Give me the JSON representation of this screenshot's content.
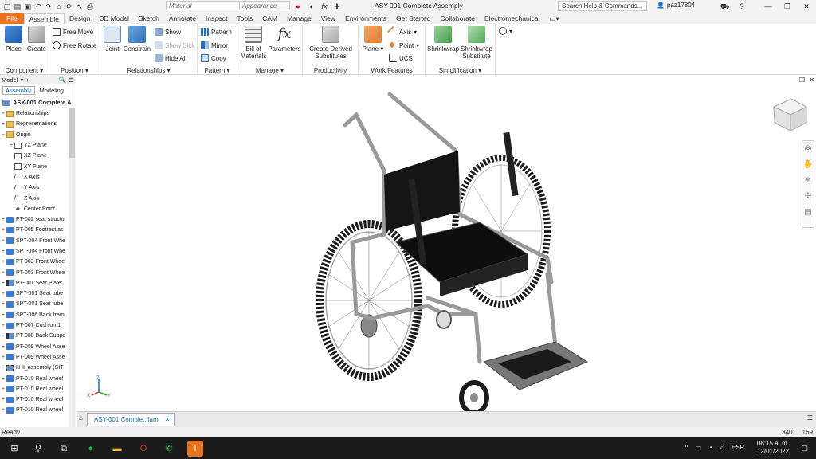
{
  "titlebar": {
    "material_placeholder": "Material",
    "appearance_placeholder": "Appearance",
    "doc_title": "ASY-001 Complete Assemply",
    "search_placeholder": "Search Help & Commands...",
    "user": "paz17804"
  },
  "tabs": [
    "File",
    "Assemble",
    "Design",
    "3D Model",
    "Sketch",
    "Annotate",
    "Inspect",
    "Tools",
    "CAM",
    "Manage",
    "View",
    "Environments",
    "Get Started",
    "Collaborate",
    "Electromechanical"
  ],
  "ribbon": {
    "component": {
      "place": "Place",
      "create": "Create",
      "label": "Component"
    },
    "position": {
      "free_move": "Free Move",
      "free_rotate": "Free Rotate",
      "label": "Position"
    },
    "relationships": {
      "joint": "Joint",
      "constrain": "Constrain",
      "show": "Show",
      "show_sick": "Show Sick",
      "hide_all": "Hide All",
      "label": "Relationships"
    },
    "pattern": {
      "pattern": "Pattern",
      "mirror": "Mirror",
      "copy": "Copy",
      "label": "Pattern"
    },
    "manage": {
      "bom": "Bill of Materials",
      "parameters": "Parameters",
      "label": "Manage"
    },
    "productivity": {
      "derived": "Create Derived Substitutes",
      "label": "Productivity"
    },
    "work_features": {
      "plane": "Plane",
      "axis": "Axis",
      "point": "Point",
      "ucs": "UCS",
      "label": "Work Features"
    },
    "simplification": {
      "shrinkwrap": "Shrinkwrap",
      "shrinkwrap_sub": "Shrinkwrap Substitute",
      "label": "Simplification"
    }
  },
  "browser": {
    "title": "Model",
    "tabs": [
      "Assembly",
      "Modeling"
    ],
    "root": "ASY-001 Complete A",
    "items": [
      {
        "label": "Relationships",
        "type": "folder",
        "exp": "+",
        "indent": 0
      },
      {
        "label": "Representations",
        "type": "folder",
        "exp": "+",
        "indent": 0
      },
      {
        "label": "Origin",
        "type": "folder",
        "exp": "−",
        "indent": 0
      },
      {
        "label": "YZ Plane",
        "type": "plane",
        "exp": "+",
        "indent": 1
      },
      {
        "label": "XZ Plane",
        "type": "plane",
        "exp": "",
        "indent": 1
      },
      {
        "label": "XY Plane",
        "type": "plane",
        "exp": "",
        "indent": 1
      },
      {
        "label": "X Axis",
        "type": "axis",
        "exp": "",
        "indent": 1
      },
      {
        "label": "Y Axis",
        "type": "axis",
        "exp": "",
        "indent": 1
      },
      {
        "label": "Z Axis",
        "type": "axis",
        "exp": "",
        "indent": 1
      },
      {
        "label": "Center Point",
        "type": "point",
        "exp": "",
        "indent": 1
      },
      {
        "label": "PT-002 seat structu",
        "type": "part",
        "exp": "+",
        "indent": 0
      },
      {
        "label": "PT-005 Footrest as",
        "type": "part",
        "exp": "+",
        "indent": 0
      },
      {
        "label": "SPT-004 Front Whe",
        "type": "part",
        "exp": "+",
        "indent": 0
      },
      {
        "label": "SPT-004 Front Whe",
        "type": "part",
        "exp": "+",
        "indent": 0
      },
      {
        "label": "PT-003 Front Whee",
        "type": "part",
        "exp": "+",
        "indent": 0
      },
      {
        "label": "PT-003 Front Whee",
        "type": "part",
        "exp": "+",
        "indent": 0
      },
      {
        "label": "PT-001 Seat Plate:",
        "type": "sheet",
        "exp": "+",
        "indent": 0
      },
      {
        "label": "SPT-001 Seat tube",
        "type": "part",
        "exp": "+",
        "indent": 0
      },
      {
        "label": "SPT-001 Seat tube",
        "type": "part",
        "exp": "+",
        "indent": 0
      },
      {
        "label": "SPT-006 Back fram",
        "type": "part",
        "exp": "+",
        "indent": 0
      },
      {
        "label": "PT-007 Cushion:1",
        "type": "part",
        "exp": "+",
        "indent": 0
      },
      {
        "label": "PT-008 Back Suppo",
        "type": "sheet",
        "exp": "+",
        "indent": 0
      },
      {
        "label": "PT-009 Wheel Asse",
        "type": "part",
        "exp": "+",
        "indent": 0
      },
      {
        "label": "PT-009 Wheel Asse",
        "type": "part",
        "exp": "+",
        "indent": 0
      },
      {
        "label": "H II_assembly (SIT",
        "type": "asm",
        "exp": "+",
        "indent": 0
      },
      {
        "label": "PT-010 Real wheel",
        "type": "part",
        "exp": "+",
        "indent": 0
      },
      {
        "label": "PT-010 Real wheel",
        "type": "part",
        "exp": "+",
        "indent": 0
      },
      {
        "label": "PT-010 Real wheel",
        "type": "part",
        "exp": "+",
        "indent": 0
      },
      {
        "label": "PT-010 Real wheel",
        "type": "part",
        "exp": "+",
        "indent": 0
      }
    ]
  },
  "doc_tab": "ASY-001 Comple...iam",
  "status": {
    "text": "Ready",
    "x": "340",
    "y": "169"
  },
  "taskbar": {
    "lang": "ESP",
    "time": "08:15 a. m.",
    "date": "12/01/2022"
  },
  "colors": {
    "file_tab": "#e8731f",
    "accent": "#1a6fbf",
    "taskbar": "#1c1c1c"
  }
}
